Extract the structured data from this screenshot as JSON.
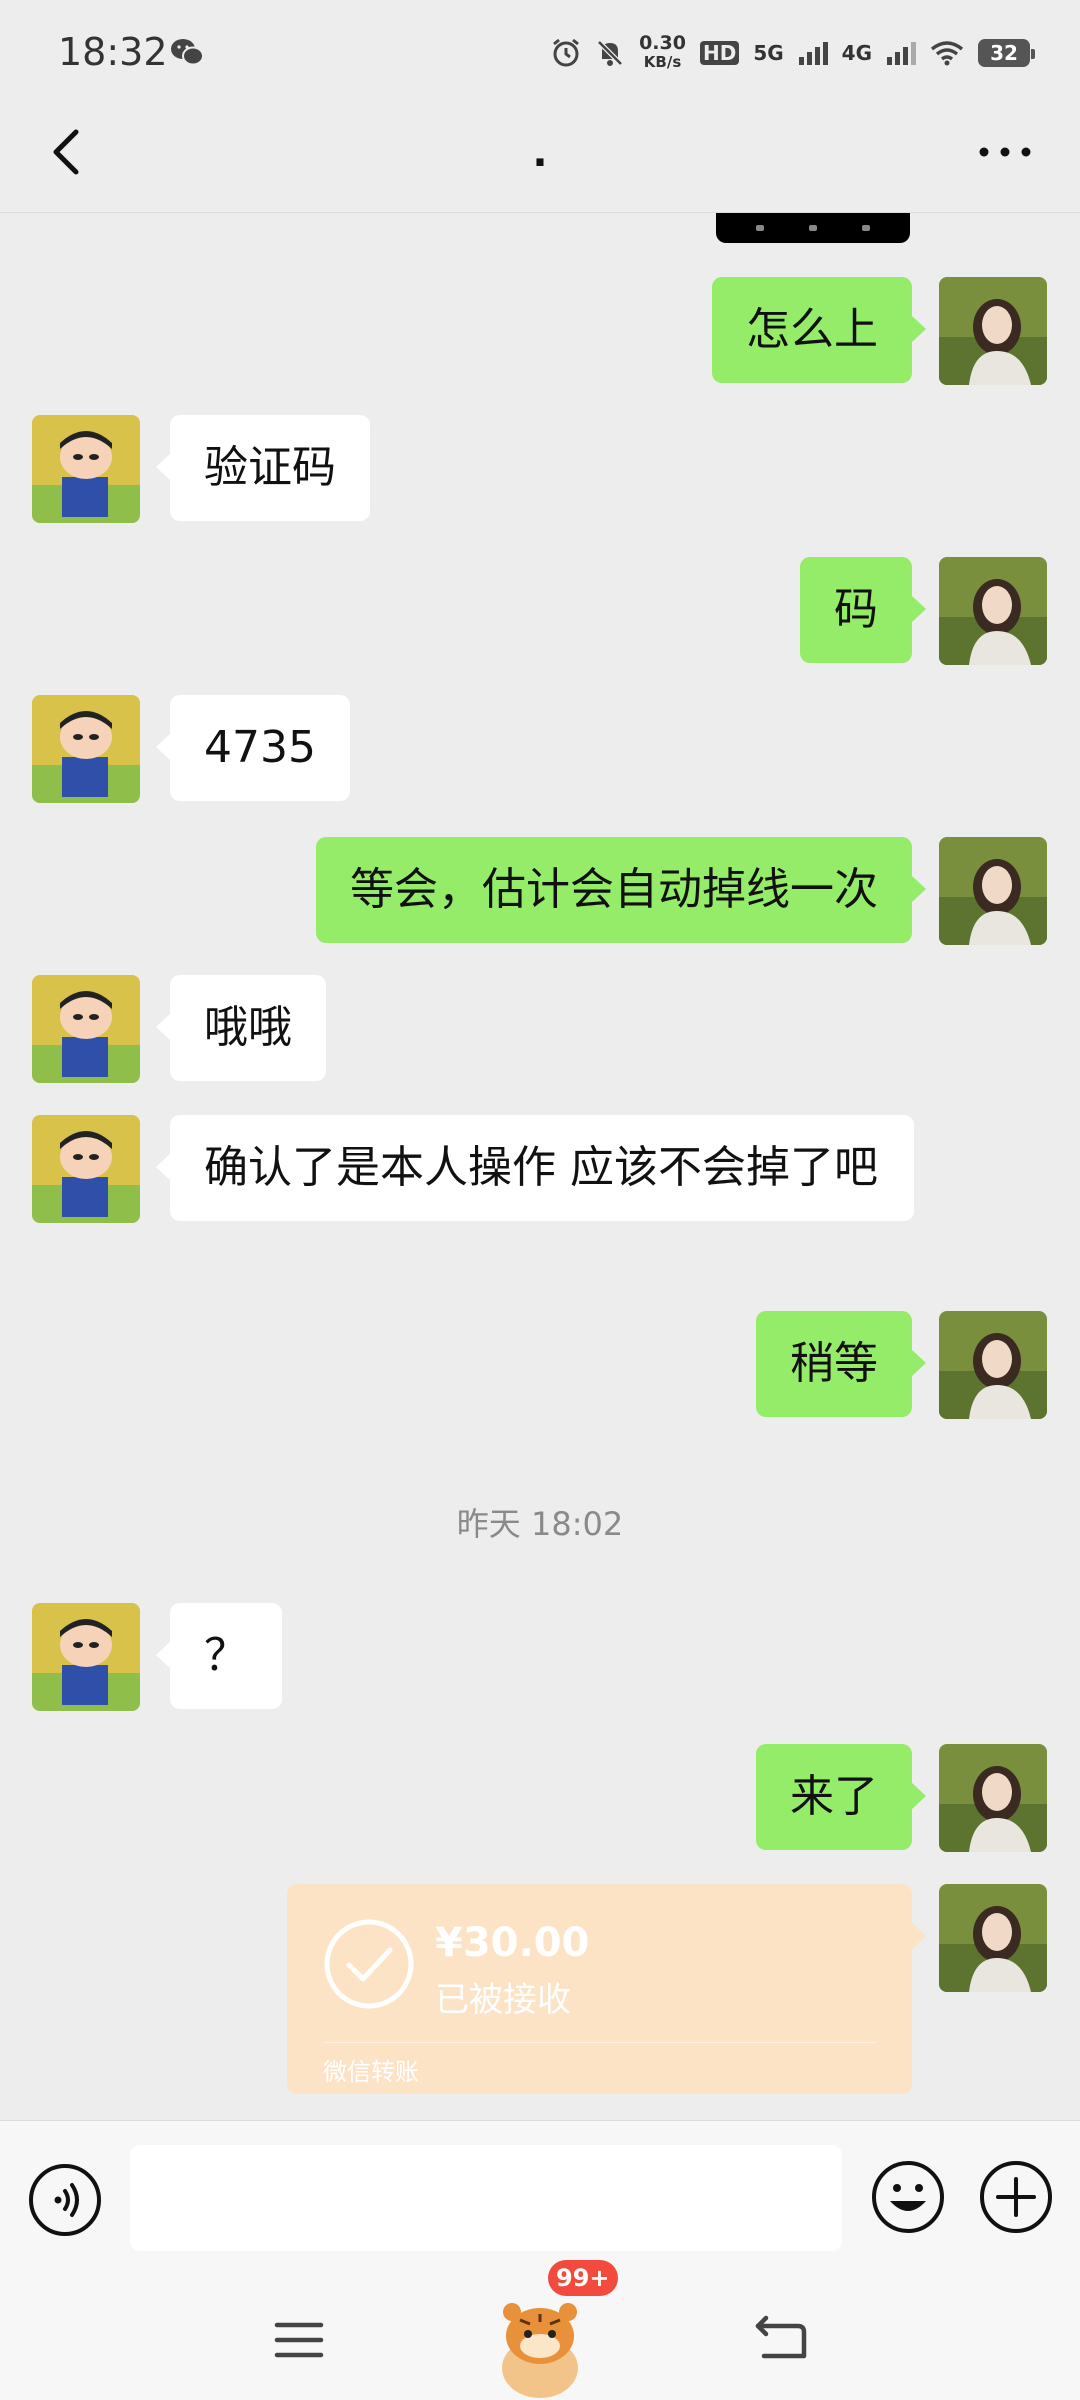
{
  "status_bar": {
    "time": "18:32",
    "net_speed_value": "0.30",
    "net_speed_unit": "KB/s",
    "hd_label": "HD",
    "net1": "5G",
    "net2": "4G",
    "battery": "32"
  },
  "header": {
    "title": "."
  },
  "messages": [
    {
      "side": "right",
      "text": "怎么上"
    },
    {
      "side": "left",
      "text": "验证码"
    },
    {
      "side": "right",
      "text": "码"
    },
    {
      "side": "left",
      "text": "4735"
    },
    {
      "side": "right",
      "text": "等会，估计会自动掉线一次"
    },
    {
      "side": "left",
      "text": "哦哦"
    },
    {
      "side": "left",
      "text": "确认了是本人操作 应该不会掉了吧"
    },
    {
      "side": "right",
      "text": "稍等"
    },
    {
      "side": "left",
      "text": "？"
    },
    {
      "side": "right",
      "text": "来了"
    }
  ],
  "timestamp": "昨天 18:02",
  "transfer": {
    "amount": "¥30.00",
    "status": "已被接收",
    "label": "微信转账"
  },
  "input": {
    "placeholder": ""
  },
  "bottom_nav": {
    "badge": "99+"
  },
  "colors": {
    "bubble_right": "#95ec69",
    "bubble_left": "#ffffff",
    "transfer_bg": "#fde3c6",
    "background": "#ededed"
  }
}
